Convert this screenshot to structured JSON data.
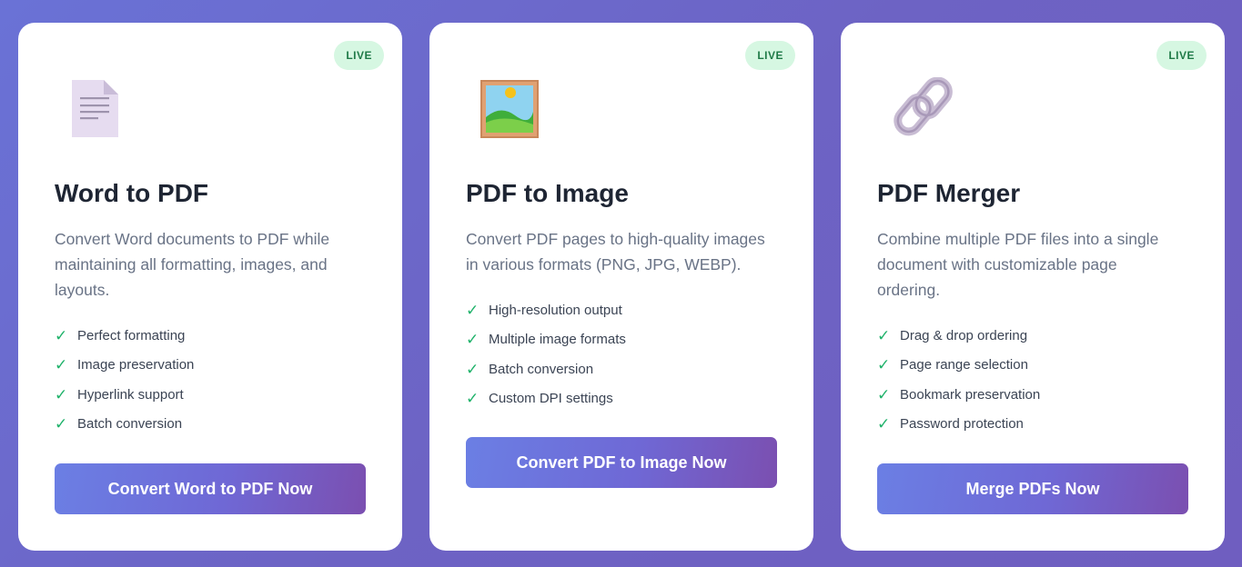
{
  "cards": [
    {
      "badge": "LIVE",
      "icon": "document-icon",
      "title": "Word to PDF",
      "description": "Convert Word documents to PDF while maintaining all formatting, images, and layouts.",
      "features": [
        "Perfect formatting",
        "Image preservation",
        "Hyperlink support",
        "Batch conversion"
      ],
      "button": "Convert Word to PDF Now"
    },
    {
      "badge": "LIVE",
      "icon": "framed-picture-icon",
      "title": "PDF to Image",
      "description": "Convert PDF pages to high-quality images in various formats (PNG, JPG, WEBP).",
      "features": [
        "High-resolution output",
        "Multiple image formats",
        "Batch conversion",
        "Custom DPI settings"
      ],
      "button": "Convert PDF to Image Now"
    },
    {
      "badge": "LIVE",
      "icon": "link-icon",
      "title": "PDF Merger",
      "description": "Combine multiple PDF files into a single document with customizable page ordering.",
      "features": [
        "Drag & drop ordering",
        "Page range selection",
        "Bookmark preservation",
        "Password protection"
      ],
      "button": "Merge PDFs Now"
    }
  ],
  "check_glyph": "✓",
  "colors": {
    "badge_bg": "#d6f7e2",
    "badge_text": "#1f7a47",
    "check": "#1fb26a",
    "button_gradient_start": "#6b7fe4",
    "button_gradient_end": "#7b4fb0"
  }
}
